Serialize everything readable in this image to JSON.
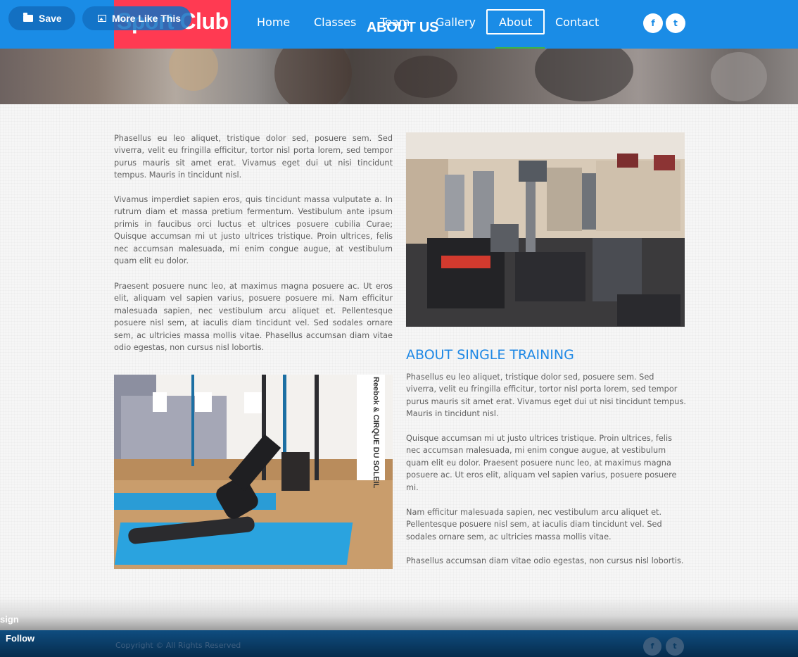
{
  "brand": {
    "logo_text": "Sport Club"
  },
  "nav": {
    "items": [
      {
        "label": "Home"
      },
      {
        "label": "Classes"
      },
      {
        "label": "Team"
      },
      {
        "label": "Gallery"
      },
      {
        "label": "About"
      },
      {
        "label": "Contact"
      }
    ],
    "active": "About"
  },
  "social": {
    "facebook_glyph": "f",
    "twitter_glyph": "t"
  },
  "overlay": {
    "save_label": "Save",
    "more_like_label": "More Like This",
    "sign_label": "sign",
    "follow_label": "Follow"
  },
  "banner": {
    "title": "ABOUT US"
  },
  "about": {
    "left_paragraphs": [
      "Phasellus eu leo aliquet, tristique dolor sed, posuere sem. Sed viverra, velit eu fringilla efficitur, tortor nisl porta lorem, sed tempor purus mauris sit amet erat. Vivamus eget dui ut nisi tincidunt tempus. Mauris in tincidunt nisl.",
      "Vivamus imperdiet sapien eros, quis tincidunt massa vulputate a. In rutrum diam et massa pretium fermentum. Vestibulum ante ipsum primis in faucibus orci luctus et ultrices posuere cubilia Curae; Quisque accumsan mi ut justo ultrices tristique. Proin ultrices, felis nec accumsan malesuada, mi enim congue augue, at vestibulum quam elit eu dolor.",
      "Praesent posuere nunc leo, at maximus magna posuere ac. Ut eros elit, aliquam vel sapien varius, posuere posuere mi. Nam efficitur malesuada sapien, nec vestibulum arcu aliquet et. Pellentesque posuere nisl sem, at iaculis diam tincidunt vel. Sed sodales ornare sem, ac ultricies massa mollis vitae. Phasellus accumsan diam vitae odio egestas, non cursus nisl lobortis."
    ],
    "training_heading": "ABOUT SINGLE TRAINING",
    "right_paragraphs": [
      "Phasellus eu leo aliquet, tristique dolor sed, posuere sem. Sed viverra, velit eu fringilla efficitur, tortor nisl porta lorem, sed tempor purus mauris sit amet erat. Vivamus eget dui ut nisi tincidunt tempus. Mauris in tincidunt nisl.",
      "Quisque accumsan mi ut justo ultrices tristique. Proin ultrices, felis nec accumsan malesuada, mi enim congue augue, at vestibulum quam elit eu dolor. Praesent posuere nunc leo, at maximus magna posuere ac. Ut eros elit, aliquam vel sapien varius, posuere posuere mi.",
      "Nam efficitur malesuada sapien, nec vestibulum arcu aliquet et. Pellentesque posuere nisl sem, at iaculis diam tincidunt vel. Sed sodales ornare sem, ac ultricies massa mollis vitae.",
      "Phasellus accumsan diam vitae odio egestas, non cursus nisl lobortis."
    ],
    "photo_sign_text": "Reebok & CIRQUE DU SOLEIL"
  },
  "footer": {
    "copyright": "Copyright © All Rights Reserved"
  },
  "colors": {
    "nav_bg": "#1a8ce6",
    "logo_bg": "#ff3a52",
    "heading_blue": "#1e88e5",
    "footer_bg": "#0a3a63"
  }
}
